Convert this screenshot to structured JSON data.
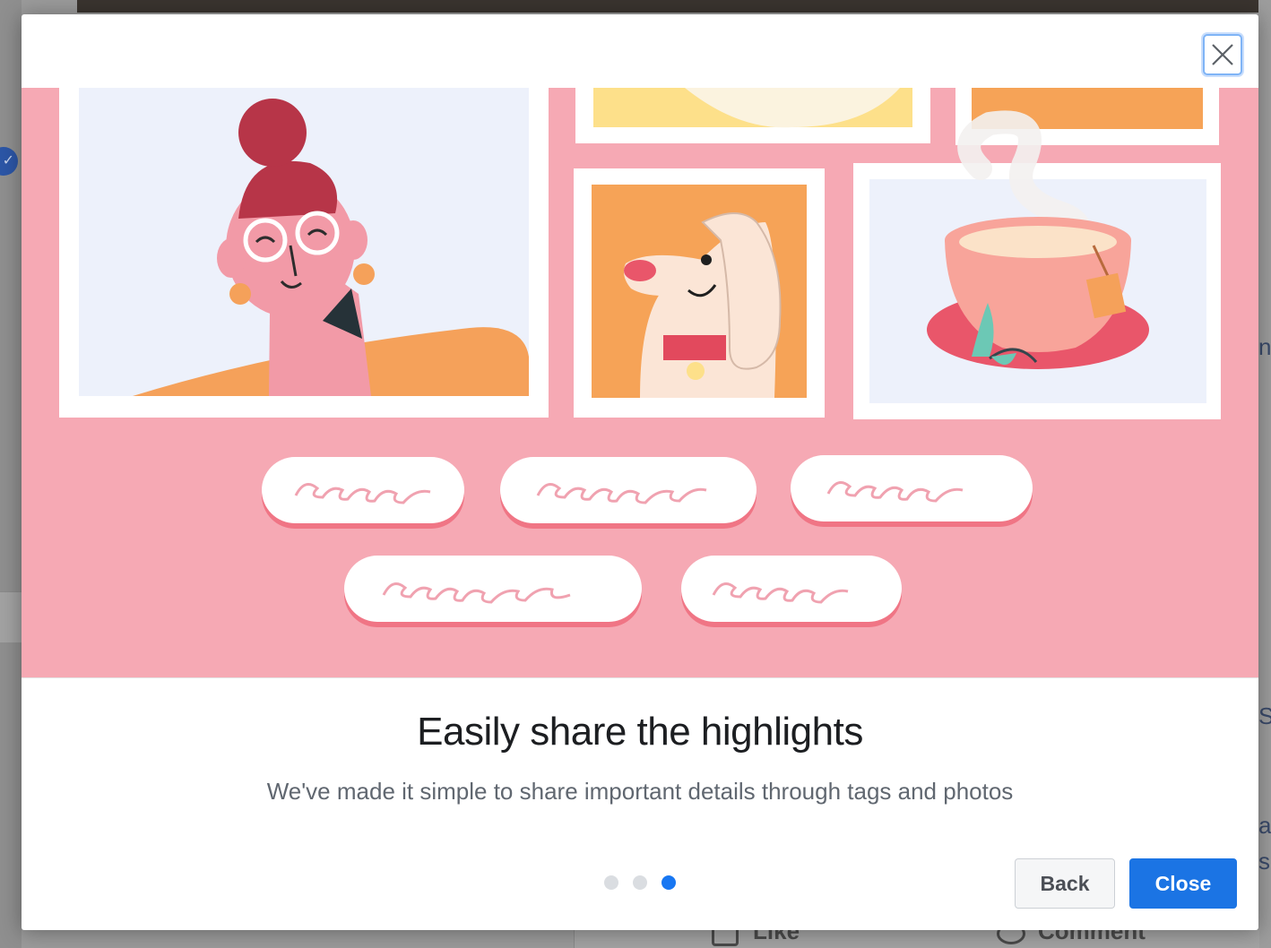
{
  "background": {
    "like_label": "Like",
    "comment_label": "Comment",
    "right_edge_text": [
      "n",
      "Sr",
      "a",
      "se"
    ]
  },
  "dialog": {
    "title": "Easily share the highlights",
    "subtitle": "We've made it simple to share important details through tags and photos",
    "pagination": {
      "current": 3,
      "total": 3
    },
    "back_label": "Back",
    "close_label": "Close",
    "close_icon": "close-x-icon"
  },
  "colors": {
    "illustration_bg": "#f6a9b4",
    "primary_button": "#1b74e4",
    "active_dot": "#1877f2",
    "inactive_dot": "#dadde1"
  }
}
